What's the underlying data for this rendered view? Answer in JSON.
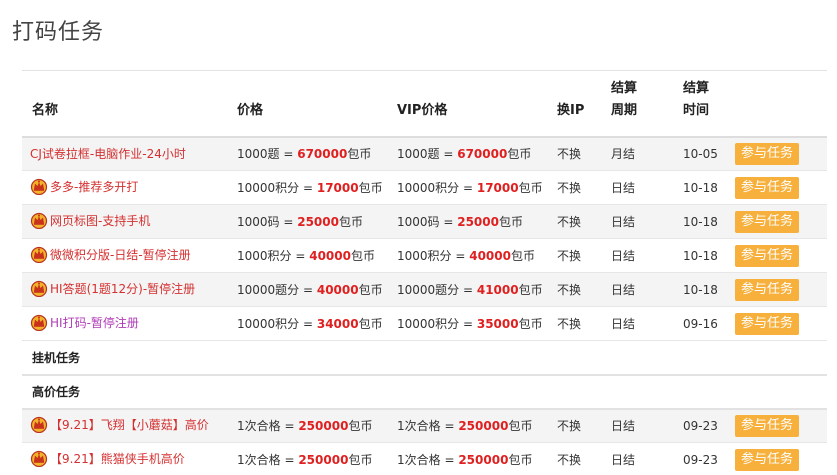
{
  "page": {
    "title": "打码任务"
  },
  "colors": {
    "accent_button": "#f7b03c",
    "amount_red": "#e02020",
    "name_red": "#d43030",
    "name_purple": "#b03ab8"
  },
  "table": {
    "headers": {
      "name": "名称",
      "price": "价格",
      "vip_price": "VIP价格",
      "change_ip": "换IP",
      "settle_cycle_line1": "结算",
      "settle_cycle_line2": "周期",
      "settle_time_line1": "结算",
      "settle_time_line2": "时间"
    },
    "join_label": "参与任务",
    "unit": "包币",
    "rows": [
      {
        "name": "CJ试卷拉框-电脑作业-24小时",
        "crown": false,
        "name_color": "red",
        "price_prefix": "1000题 = ",
        "price_amount": "670000",
        "vip_prefix": "1000题 = ",
        "vip_amount": "670000",
        "change_ip": "不换",
        "cycle": "月结",
        "time": "10-05"
      },
      {
        "name": "多多-推荐多开打",
        "crown": true,
        "name_color": "red",
        "price_prefix": "10000积分 = ",
        "price_amount": "17000",
        "vip_prefix": "10000积分 = ",
        "vip_amount": "17000",
        "change_ip": "不换",
        "cycle": "日结",
        "time": "10-18"
      },
      {
        "name": "网页标图-支持手机",
        "crown": true,
        "name_color": "red",
        "price_prefix": "1000码 = ",
        "price_amount": "25000",
        "vip_prefix": "1000码 = ",
        "vip_amount": "25000",
        "change_ip": "不换",
        "cycle": "日结",
        "time": "10-18"
      },
      {
        "name": "微微积分版-日结-暂停注册",
        "crown": true,
        "name_color": "red",
        "price_prefix": "1000积分 = ",
        "price_amount": "40000",
        "vip_prefix": "1000积分 = ",
        "vip_amount": "40000",
        "change_ip": "不换",
        "cycle": "日结",
        "time": "10-18"
      },
      {
        "name": "HI答题(1题12分)-暂停注册",
        "crown": true,
        "name_color": "red",
        "price_prefix": "10000题分 = ",
        "price_amount": "40000",
        "vip_prefix": "10000题分 = ",
        "vip_amount": "41000",
        "change_ip": "不换",
        "cycle": "日结",
        "time": "10-18"
      },
      {
        "name": "HI打码-暂停注册",
        "crown": true,
        "name_color": "purple",
        "price_prefix": "10000积分 = ",
        "price_amount": "34000",
        "vip_prefix": "10000积分 = ",
        "vip_amount": "35000",
        "change_ip": "不换",
        "cycle": "日结",
        "time": "09-16"
      }
    ],
    "sections": [
      {
        "title": "挂机任务",
        "rows": []
      },
      {
        "title": "高价任务",
        "rows": [
          {
            "name": "【9.21】飞翔【小蘑菇】高价",
            "crown": true,
            "name_color": "red",
            "price_prefix": "1次合格 = ",
            "price_amount": "250000",
            "vip_prefix": "1次合格 = ",
            "vip_amount": "250000",
            "change_ip": "不换",
            "cycle": "日结",
            "time": "09-23"
          },
          {
            "name": "【9.21】熊猫侠手机高价",
            "crown": true,
            "name_color": "red",
            "price_prefix": "1次合格 = ",
            "price_amount": "250000",
            "vip_prefix": "1次合格 = ",
            "vip_amount": "250000",
            "change_ip": "不换",
            "cycle": "日结",
            "time": "09-23"
          }
        ]
      }
    ]
  }
}
